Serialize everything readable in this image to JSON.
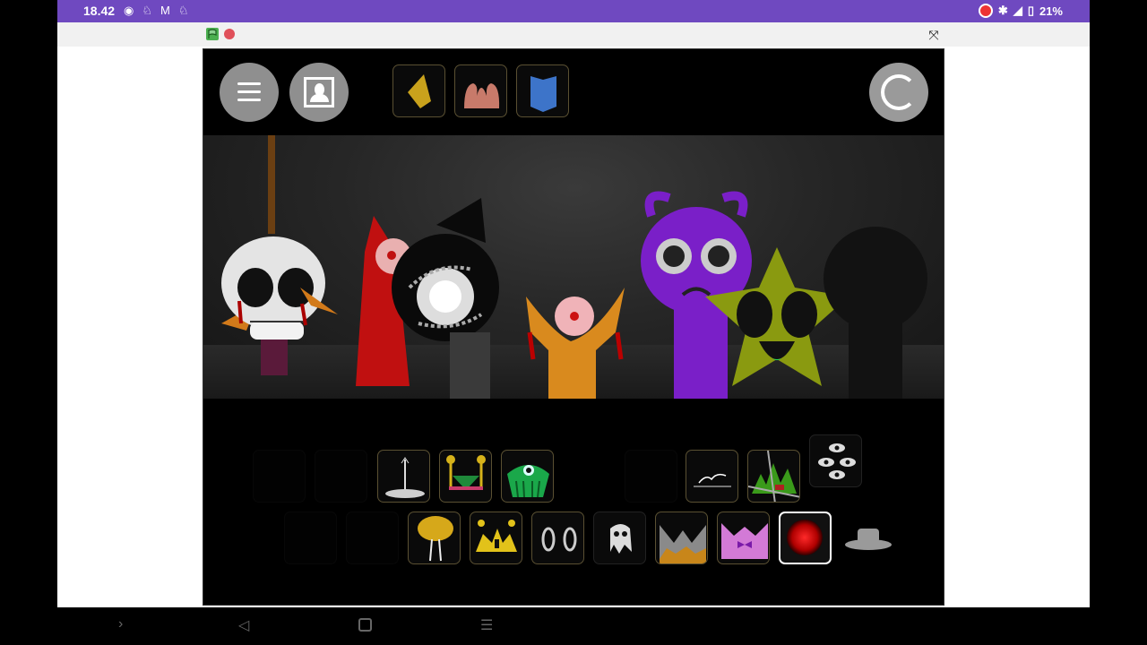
{
  "status_bar": {
    "time": "18.42",
    "battery": "21%",
    "left_icons": [
      "vpn-icon",
      "notification-icon",
      "gmail-icon",
      "notification-icon"
    ],
    "right_icons": [
      "screen-record-icon",
      "bluetooth-icon",
      "wifi-icon",
      "battery-icon"
    ]
  },
  "browser_bar": {
    "icons": [
      "green-flag-icon",
      "stop-icon",
      "fullscreen-exit-icon"
    ]
  },
  "game": {
    "top_buttons": [
      "menu-button",
      "portrait-button",
      "reset-button"
    ],
    "top_tiles": [
      {
        "name": "yellow-diamond-tile",
        "color": "#c9a21c"
      },
      {
        "name": "pink-hands-tile",
        "color": "#c87a6a"
      },
      {
        "name": "blue-shield-tile",
        "color": "#3d74c9"
      }
    ],
    "scene_characters": [
      {
        "name": "skull-character",
        "color": "#e6e6e6"
      },
      {
        "name": "red-hooded-character",
        "color": "#c01010"
      },
      {
        "name": "black-cat-orb-character",
        "color": "#111111"
      },
      {
        "name": "orange-eye-character",
        "color": "#d98a1e"
      },
      {
        "name": "purple-sad-character",
        "color": "#7a1fc8"
      },
      {
        "name": "yellow-star-character",
        "color": "#9aaa10"
      },
      {
        "name": "shadow-character",
        "color": "#111111"
      }
    ],
    "row1_tiles": [
      {
        "name": "antenna-tile"
      },
      {
        "name": "yellow-bolts-tile"
      },
      {
        "name": "green-eye-tile"
      },
      {
        "name": "scribble-tile"
      },
      {
        "name": "green-spikes-tile"
      },
      {
        "name": "triple-eyes-tile"
      }
    ],
    "row2_tiles": [
      {
        "name": "mushroom-tile"
      },
      {
        "name": "yellow-crown-tile"
      },
      {
        "name": "white-eyes-tile"
      },
      {
        "name": "ghost-face-tile"
      },
      {
        "name": "grey-spikes-tile"
      },
      {
        "name": "pink-bow-tile"
      },
      {
        "name": "red-orb-tile",
        "selected": true
      },
      {
        "name": "grey-hat-tile"
      }
    ]
  },
  "nav_bar": {
    "icons": [
      "chevron-right-icon",
      "back-icon",
      "home-icon",
      "recents-icon"
    ]
  }
}
